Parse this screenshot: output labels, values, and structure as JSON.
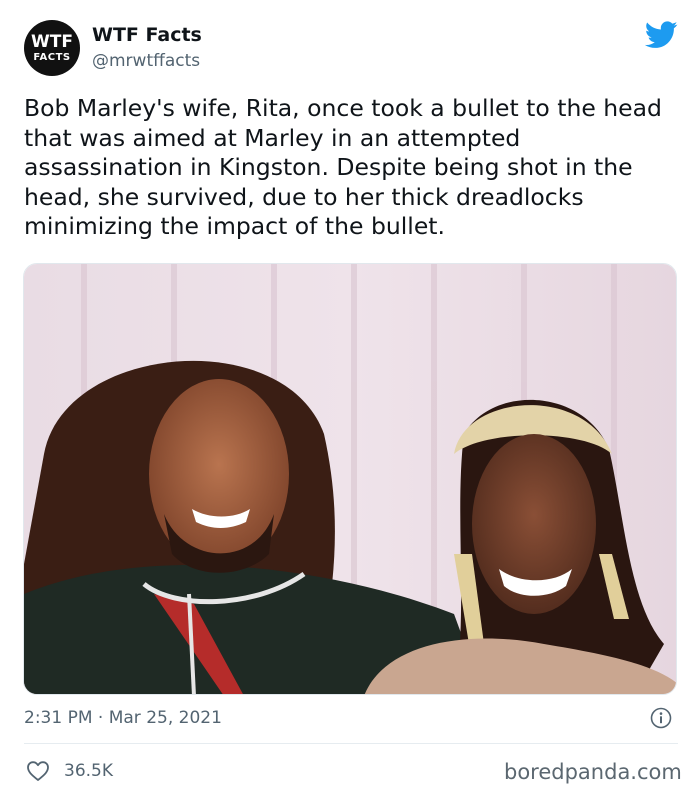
{
  "author": {
    "avatar_line1": "WTF",
    "avatar_line2": "FACTS",
    "display_name": "WTF Facts",
    "handle": "@mrwtffacts"
  },
  "tweet": {
    "text": "Bob Marley's wife, Rita, once took a bullet to the head that was aimed at Marley in an attempted assassination in Kingston. Despite being shot in the head, she survived, due to her thick dreadlocks minimizing the impact of the bullet.",
    "timestamp": "2:31 PM · Mar 25, 2021",
    "likes": "36.5K"
  },
  "watermark": "boredpanda.com",
  "icons": {
    "platform": "twitter-bird-icon",
    "info": "info-icon",
    "like": "heart-icon"
  },
  "colors": {
    "twitter_blue": "#1d9bf0",
    "secondary_text": "#536471",
    "primary_text": "#0f1419"
  }
}
